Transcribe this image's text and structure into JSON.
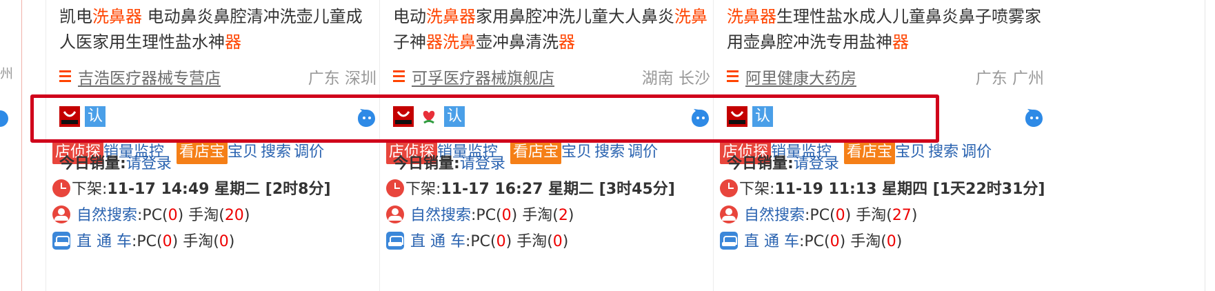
{
  "edge": {
    "left_text": "州"
  },
  "cards": [
    {
      "title_parts": [
        {
          "t": "凯电",
          "hl": false
        },
        {
          "t": "洗鼻器",
          "hl": true
        },
        {
          "t": " 电动鼻炎鼻腔清冲洗壶儿童成人医家用生理性盐水神",
          "hl": false
        },
        {
          "t": "器",
          "hl": true
        }
      ],
      "shop_name": "吉浩医疗器械专营店",
      "location": "广东 深圳",
      "badges": [
        "tmall",
        "ren"
      ],
      "ren_label": "认",
      "tools": {
        "shop_detective": "店侦探",
        "sales_monitor": "销量监控",
        "shop_treasure": "看店宝",
        "item": "宝贝",
        "search": "搜索",
        "price": "调价"
      },
      "today_sales_label": "今日销量:",
      "login_text": "请登录",
      "offshelf_label": "下架:",
      "offshelf_value": "11-17 14:49 星期二 [2时8分]",
      "natural_label": "自然搜索",
      "pc_prefix": ":PC(",
      "natural_pc": "0",
      "mobile_prefix": ") 手淘(",
      "natural_mobile": "20",
      "close_paren": ")",
      "ztc_label": "直 通 车",
      "ztc_pc": "0",
      "ztc_mobile": "0"
    },
    {
      "title_parts": [
        {
          "t": "电动",
          "hl": false
        },
        {
          "t": "洗鼻器",
          "hl": true
        },
        {
          "t": "家用鼻腔冲洗儿童大人鼻炎",
          "hl": false
        },
        {
          "t": "洗鼻",
          "hl": true
        },
        {
          "t": "子神",
          "hl": false
        },
        {
          "t": "器洗鼻",
          "hl": true
        },
        {
          "t": "壶冲鼻清洗",
          "hl": false
        },
        {
          "t": "器",
          "hl": true
        }
      ],
      "shop_name": "可孚医疗器械旗舰店",
      "location": "湖南 长沙",
      "badges": [
        "tmall",
        "heart",
        "ren"
      ],
      "ren_label": "认",
      "tools": {
        "shop_detective": "店侦探",
        "sales_monitor": "销量监控",
        "shop_treasure": "看店宝",
        "item": "宝贝",
        "search": "搜索",
        "price": "调价"
      },
      "today_sales_label": "今日销量:",
      "login_text": "请登录",
      "offshelf_label": "下架:",
      "offshelf_value": "11-17 16:27 星期二 [3时45分]",
      "natural_label": "自然搜索",
      "pc_prefix": ":PC(",
      "natural_pc": "0",
      "mobile_prefix": ") 手淘(",
      "natural_mobile": "2",
      "close_paren": ")",
      "ztc_label": "直 通 车",
      "ztc_pc": "0",
      "ztc_mobile": "0"
    },
    {
      "title_parts": [
        {
          "t": "洗鼻器",
          "hl": true
        },
        {
          "t": "生理性盐水成人儿童鼻炎鼻子喷雾家用壶鼻腔冲洗专用盐神",
          "hl": false
        },
        {
          "t": "器",
          "hl": true
        }
      ],
      "shop_name": "阿里健康大药房",
      "location": "广东 广州",
      "badges": [
        "tmall",
        "ren"
      ],
      "ren_label": "认",
      "tools": {
        "shop_detective": "店侦探",
        "sales_monitor": "销量监控",
        "shop_treasure": "看店宝",
        "item": "宝贝",
        "search": "搜索",
        "price": "调价"
      },
      "today_sales_label": "今日销量:",
      "login_text": "请登录",
      "offshelf_label": "下架:",
      "offshelf_value": "11-19 11:13 星期四 [1天22时31分]",
      "natural_label": "自然搜索",
      "pc_prefix": ":PC(",
      "natural_pc": "0",
      "mobile_prefix": ") 手淘(",
      "natural_mobile": "27",
      "close_paren": ")",
      "ztc_label": "直 通 车",
      "ztc_pc": "0",
      "ztc_mobile": "0"
    }
  ],
  "colors": {
    "highlight": "#ff4400",
    "box": "#d0021b",
    "link": "#2a63b0",
    "number_red": "#ee0000"
  }
}
